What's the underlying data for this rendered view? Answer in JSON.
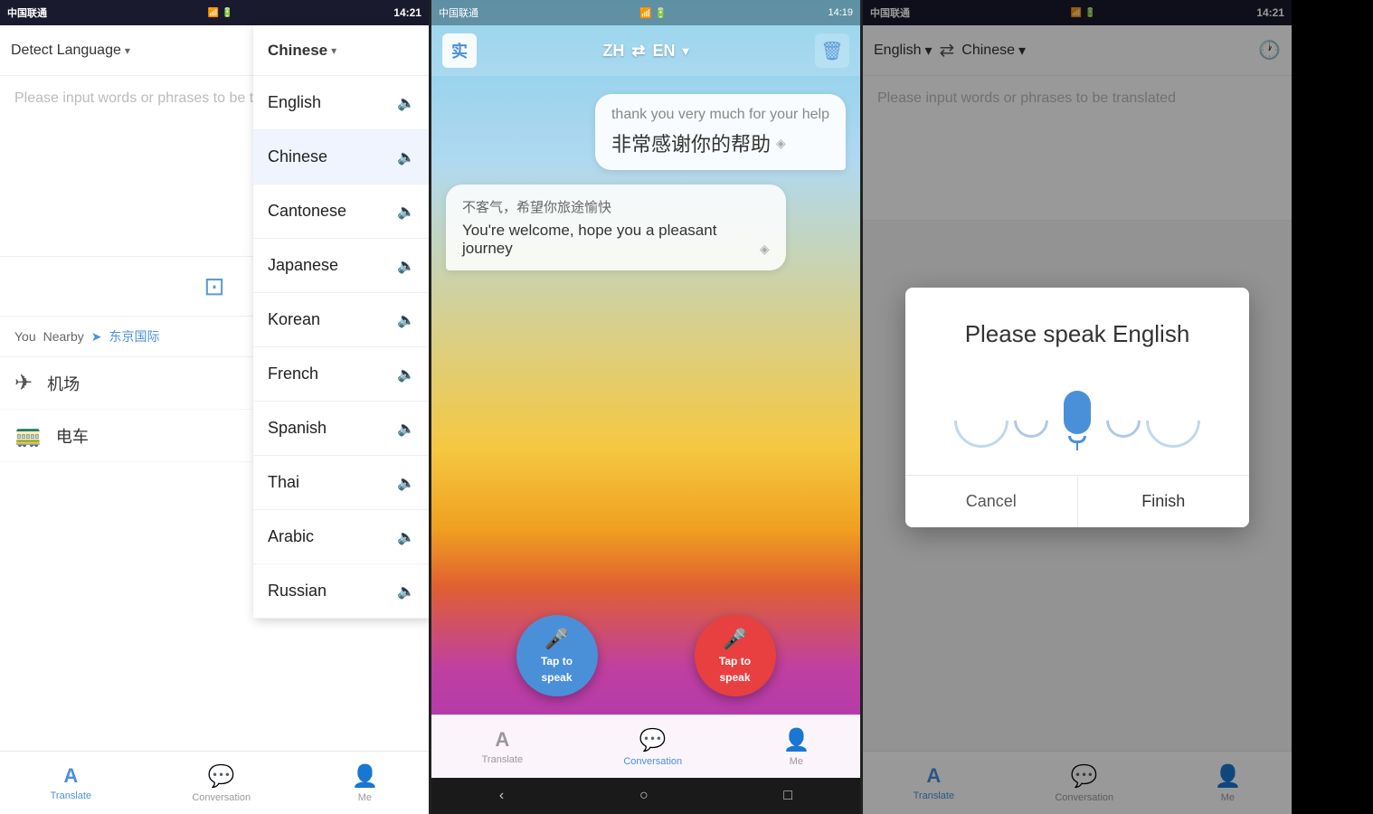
{
  "screens": {
    "screen1": {
      "status_bar": {
        "carrier": "中国联通",
        "time": "14:21"
      },
      "top_bar": {
        "detect_label": "Detect Language",
        "swap_label": "⇄"
      },
      "input_placeholder": "Please input words or phrases to be translated",
      "camera_label": "camera",
      "location": {
        "you": "You",
        "nearby": "Nearby",
        "name": "东京国际"
      },
      "quick_items": [
        {
          "icon": "✈",
          "text": "机场"
        },
        {
          "icon": "🚃",
          "text": "电车"
        }
      ],
      "dropdown": {
        "selected": "Chinese",
        "items": [
          {
            "label": "English",
            "active": false
          },
          {
            "label": "Chinese",
            "active": true
          },
          {
            "label": "Cantonese",
            "active": false
          },
          {
            "label": "Japanese",
            "active": false
          },
          {
            "label": "Korean",
            "active": false
          },
          {
            "label": "French",
            "active": false
          },
          {
            "label": "Spanish",
            "active": false
          },
          {
            "label": "Thai",
            "active": false
          },
          {
            "label": "Arabic",
            "active": false
          },
          {
            "label": "Russian",
            "active": false
          }
        ]
      },
      "bottom_nav": [
        {
          "icon": "A",
          "label": "Translate",
          "active": true
        },
        {
          "icon": "💬",
          "label": "Conversation",
          "active": false
        },
        {
          "icon": "👤",
          "label": "Me",
          "active": false
        }
      ]
    },
    "screen2": {
      "status_bar": {
        "carrier": "中国联通",
        "time": "14:19"
      },
      "top_bar": {
        "icon_label": "实",
        "lang_from": "ZH",
        "swap": "⇄",
        "lang_to": "EN"
      },
      "chat": {
        "bubble_right": {
          "en": "thank you very much for your help",
          "zh": "非常感谢你的帮助"
        },
        "bubble_left": {
          "zh": "不客气，希望你旅途愉快",
          "en": "You're welcome, hope you a pleasant journey"
        }
      },
      "speak_buttons": [
        {
          "label": "Tap to\nspeak",
          "color": "blue"
        },
        {
          "label": "Tap to\nspeak",
          "color": "red"
        }
      ],
      "bottom_nav": [
        {
          "icon": "A",
          "label": "Translate",
          "active": false
        },
        {
          "icon": "💬",
          "label": "Conversation",
          "active": true
        },
        {
          "icon": "👤",
          "label": "Me",
          "active": false
        }
      ],
      "android_nav": [
        "‹",
        "○",
        "□"
      ]
    },
    "screen3": {
      "status_bar": {
        "carrier": "中国联通",
        "time": "14:21"
      },
      "top_bar": {
        "lang_from": "English",
        "swap": "⇄",
        "lang_to": "Chinese"
      },
      "input_placeholder": "Please input words or phrases to be translated",
      "dialog": {
        "title": "Please speak English",
        "cancel": "Cancel",
        "finish": "Finish"
      },
      "bottom_nav": [
        {
          "icon": "A",
          "label": "Translate",
          "active": true
        },
        {
          "icon": "💬",
          "label": "Conversation",
          "active": false
        },
        {
          "icon": "👤",
          "label": "Me",
          "active": false
        }
      ]
    }
  }
}
